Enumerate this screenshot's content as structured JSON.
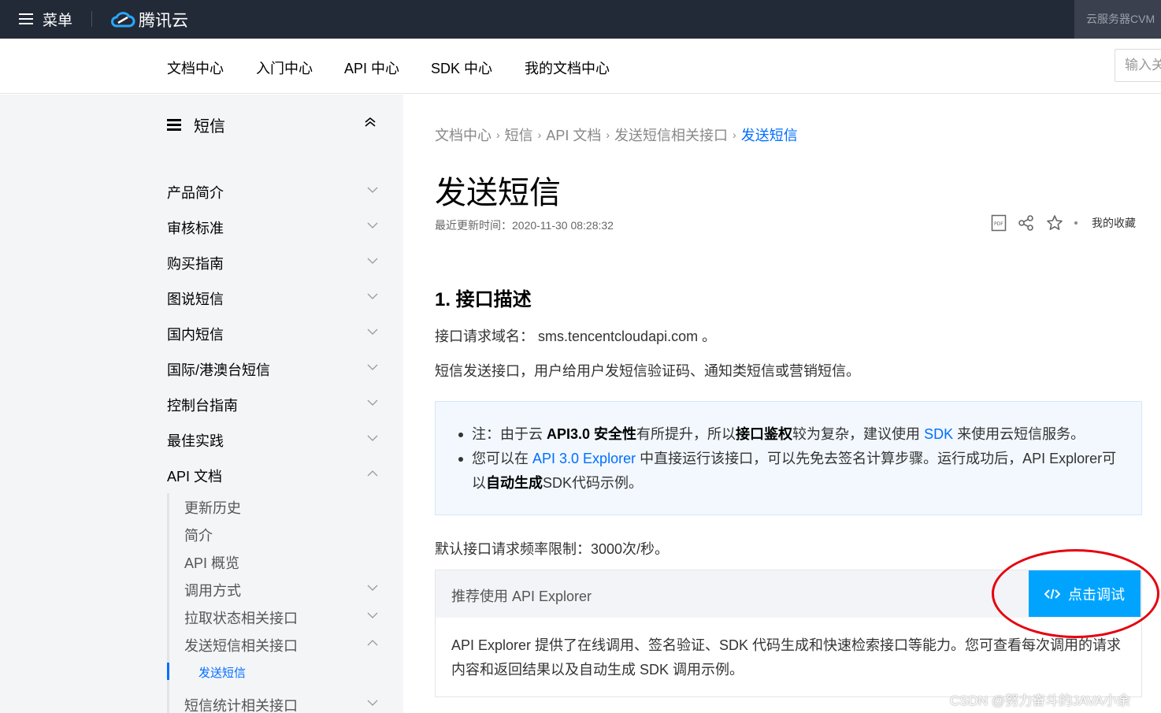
{
  "topbar": {
    "menu_label": "菜单",
    "logo_text": "腾讯云",
    "right_label": "云服务器CVM"
  },
  "subnav": {
    "items": [
      "文档中心",
      "入门中心",
      "API 中心",
      "SDK 中心",
      "我的文档中心"
    ],
    "search_text": "输入关"
  },
  "sidebar": {
    "title": "短信",
    "items": [
      "产品简介",
      "审核标准",
      "购买指南",
      "图说短信",
      "国内短信",
      "国际/港澳台短信",
      "控制台指南",
      "最佳实践",
      "API 文档"
    ],
    "sub_items": [
      "更新历史",
      "简介",
      "API 概览",
      "调用方式",
      "拉取状态相关接口",
      "发送短信相关接口"
    ],
    "active_item": "发送短信",
    "next_item": "短信统计相关接口"
  },
  "breadcrumb": {
    "items": [
      "文档中心",
      "短信",
      "API 文档",
      "发送短信相关接口"
    ],
    "current": "发送短信"
  },
  "page": {
    "title": "发送短信",
    "update_time": "最近更新时间：2020-11-30 08:28:32",
    "favorites_label": "我的收藏",
    "section_title": "1. 接口描述",
    "domain_line": "接口请求域名： sms.tencentcloudapi.com 。",
    "description": "短信发送接口，用户给用户发短信验证码、通知类短信或营销短信。",
    "rate_limit": "默认接口请求频率限制：3000次/秒。"
  },
  "notice": {
    "line1_a": "注：由于云 ",
    "line1_b": "API3.0 安全性",
    "line1_c": "有所提升，所以",
    "line1_d": "接口鉴权",
    "line1_e": "较为复杂，建议使用 ",
    "line1_link": "SDK",
    "line1_f": " 来使用云短信服务。",
    "line2_a": "您可以在 ",
    "line2_link": "API 3.0 Explorer",
    "line2_b": " 中直接运行该接口，可以先免去签名计算步骤。运行成功后，API Explorer可以",
    "line2_c": "自动生成",
    "line2_d": "SDK代码示例。"
  },
  "explorer": {
    "title": "推荐使用 API Explorer",
    "button_label": "点击调试",
    "body": "API Explorer 提供了在线调用、签名验证、SDK 代码生成和快速检索接口等能力。您可查看每次调用的请求内容和返回结果以及自动生成 SDK 调用示例。"
  },
  "watermark": "CSDN @努力奋斗的JAVA小余",
  "colors": {
    "topbar_bg": "#232a37",
    "accent_blue": "#006eff",
    "button_blue": "#00a4ff",
    "annotation_red": "#e6000e",
    "sidebar_bg": "#f4f5f7"
  }
}
